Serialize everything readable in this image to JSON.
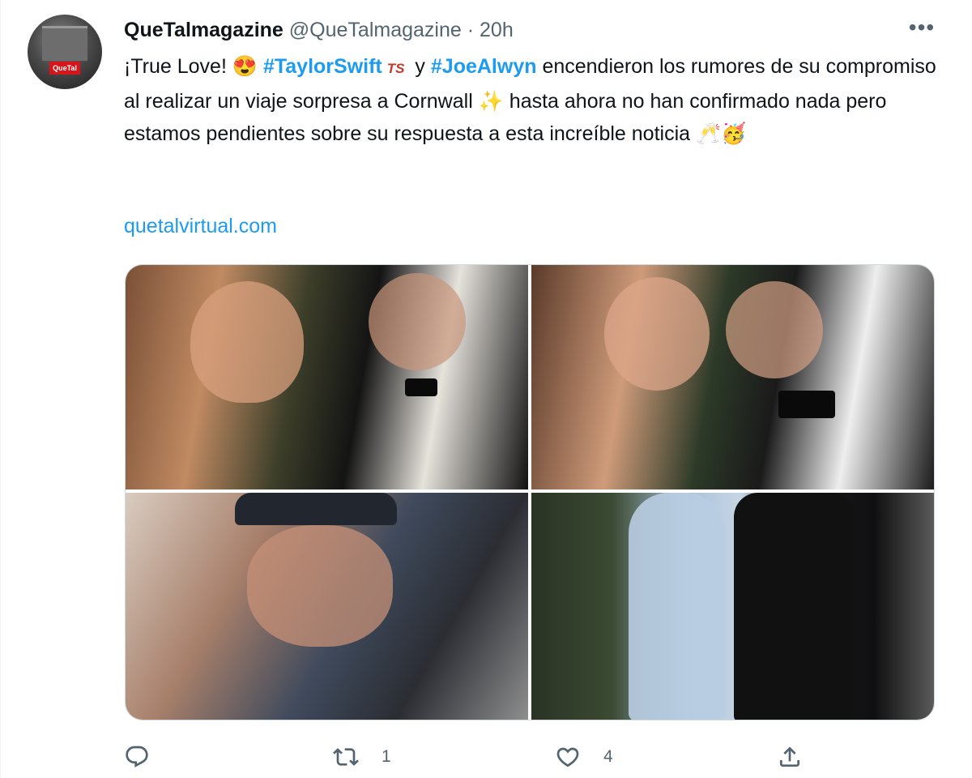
{
  "tweet": {
    "author_name": "QueTalmagazine",
    "author_handle": "@QueTalmagazine",
    "separator": "·",
    "time": "20h",
    "more_label": "•••",
    "avatar_badge": "QueTal",
    "text_segments": {
      "s1": "¡True Love! ",
      "hashtag1": "#TaylorSwift",
      "ts_glyph": "TS",
      "s2": " y ",
      "hashtag2": "#JoeAlwyn",
      "s3": " encendieron los rumores de su compromiso al realizar un viaje sorpresa a Cornwall ",
      "s4": " hasta ahora no han confirmado nada pero estamos pendientes sobre su respuesta a esta increíble noticia "
    },
    "link": "quetalvirtual.com",
    "emoji": {
      "heart_eyes": "😍",
      "sparkles": "✨",
      "champagne": "🥂",
      "party_face": "🥳"
    },
    "media_count": 4,
    "actions": {
      "reply_count": "",
      "retweet_count": "1",
      "like_count": "4"
    }
  },
  "colors": {
    "accent": "#1d9bf0",
    "text": "#0f1419",
    "muted": "#536471",
    "border": "#cfd9de"
  }
}
